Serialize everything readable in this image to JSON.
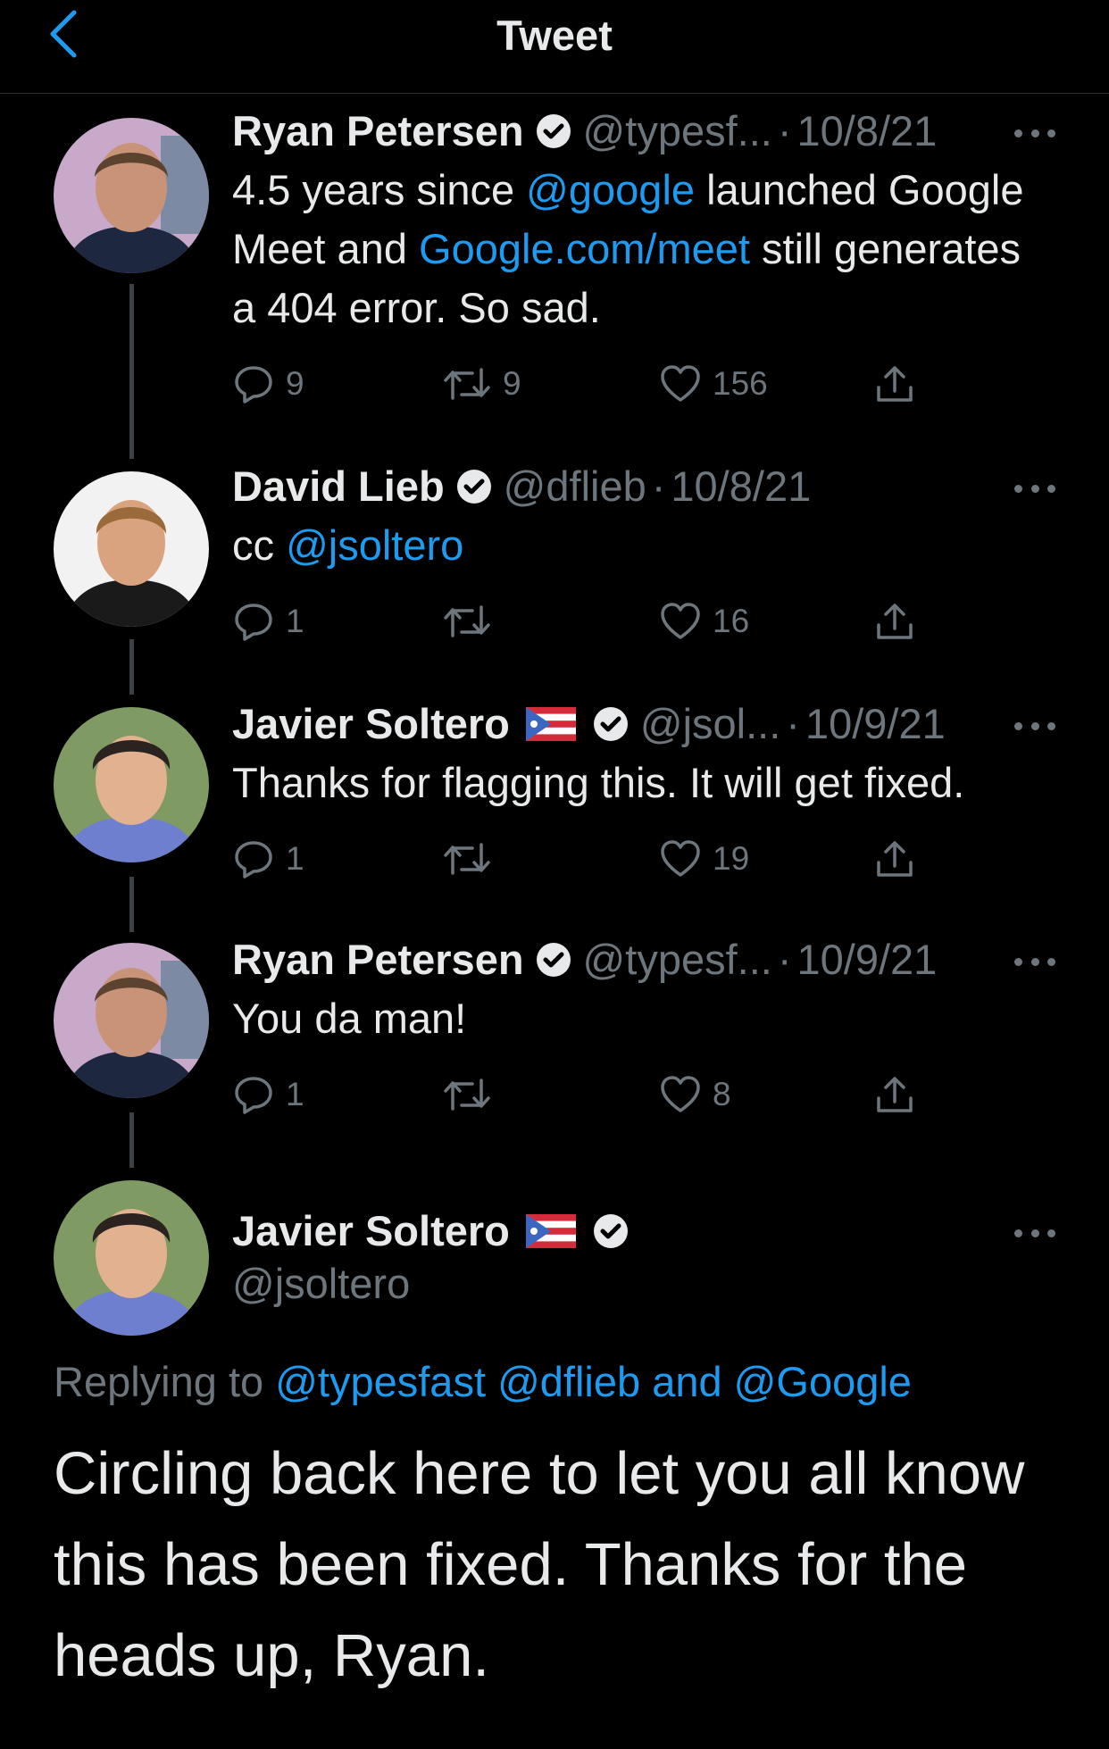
{
  "header": {
    "title": "Tweet"
  },
  "colors": {
    "link": "#1d9bf0",
    "muted": "#6e767d",
    "background": "#000000"
  },
  "tweets": [
    {
      "name": "Ryan Petersen",
      "handle": "@typesf...",
      "date": "10/8/21",
      "text": {
        "t1": "4.5 years since ",
        "l1": "@google",
        "t2": " launched Google Meet and ",
        "l2": "Google.com/meet",
        "t3": " still generates a 404 error. So sad."
      },
      "replies": "9",
      "retweets": "9",
      "likes": "156"
    },
    {
      "name": "David Lieb",
      "handle": "@dflieb",
      "date": "10/8/21",
      "text": {
        "t1": "cc ",
        "l1": "@jsoltero"
      },
      "replies": "1",
      "retweets": "",
      "likes": "16"
    },
    {
      "name": "Javier Soltero",
      "handle": "@jsol...",
      "date": "10/9/21",
      "text": {
        "t1": "Thanks for flagging this. It will get fixed."
      },
      "replies": "1",
      "retweets": "",
      "likes": "19"
    },
    {
      "name": "Ryan Petersen",
      "handle": "@typesf...",
      "date": "10/9/21",
      "text": {
        "t1": "You da man!"
      },
      "replies": "1",
      "retweets": "",
      "likes": "8"
    }
  ],
  "main": {
    "name": "Javier Soltero",
    "handle": "@jsoltero",
    "replying_prefix": "Replying to ",
    "replying_to": "@typesfast @dflieb and @Google",
    "text": "Circling back here to let you all know this has been fixed. Thanks for the heads up, Ryan."
  }
}
